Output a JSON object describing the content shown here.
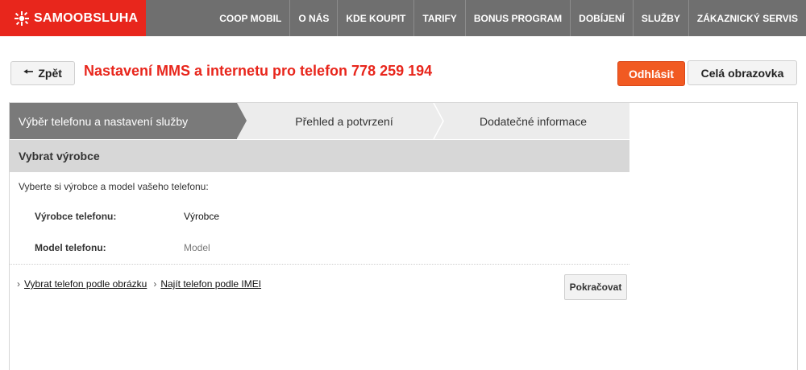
{
  "brand": {
    "name": "SAMOOBSLUHA",
    "color": "#e8261c"
  },
  "nav": {
    "items": [
      {
        "label": "COOP MOBIL"
      },
      {
        "label": "O NÁS"
      },
      {
        "label": "KDE KOUPIT"
      },
      {
        "label": "TARIFY"
      },
      {
        "label": "BONUS PROGRAM"
      },
      {
        "label": "DOBÍJENÍ"
      },
      {
        "label": "SLUŽBY"
      },
      {
        "label": "ZÁKAZNICKÝ SERVIS"
      }
    ]
  },
  "header": {
    "back_label": "Zpět",
    "back_icon": "arrow-left-icon",
    "title": "Nastavení MMS a internetu pro telefon 778 259 194",
    "logout_label": "Odhlásit",
    "fullscreen_label": "Celá obrazovka"
  },
  "steps": [
    {
      "label": "Výběr telefonu a nastavení služby",
      "active": true
    },
    {
      "label": "Přehled a potvrzení",
      "active": false
    },
    {
      "label": "Dodatečné informace",
      "active": false
    }
  ],
  "section": {
    "title": "Vybrat výrobce",
    "intro": "Vyberte si výrobce a model vašeho telefonu:",
    "maker_label": "Výrobce telefonu:",
    "maker_value": "Výrobce",
    "model_label": "Model telefonu:",
    "model_value": "Model"
  },
  "links": [
    {
      "label": "Vybrat telefon podle obrázku"
    },
    {
      "label": "Najít telefon podle IMEI"
    }
  ],
  "continue_label": "Pokračovat",
  "colors": {
    "accent": "#e8261c",
    "logout": "#f15a22",
    "nav_bg": "#6f6f6f",
    "step_active": "#7a7a7a"
  }
}
